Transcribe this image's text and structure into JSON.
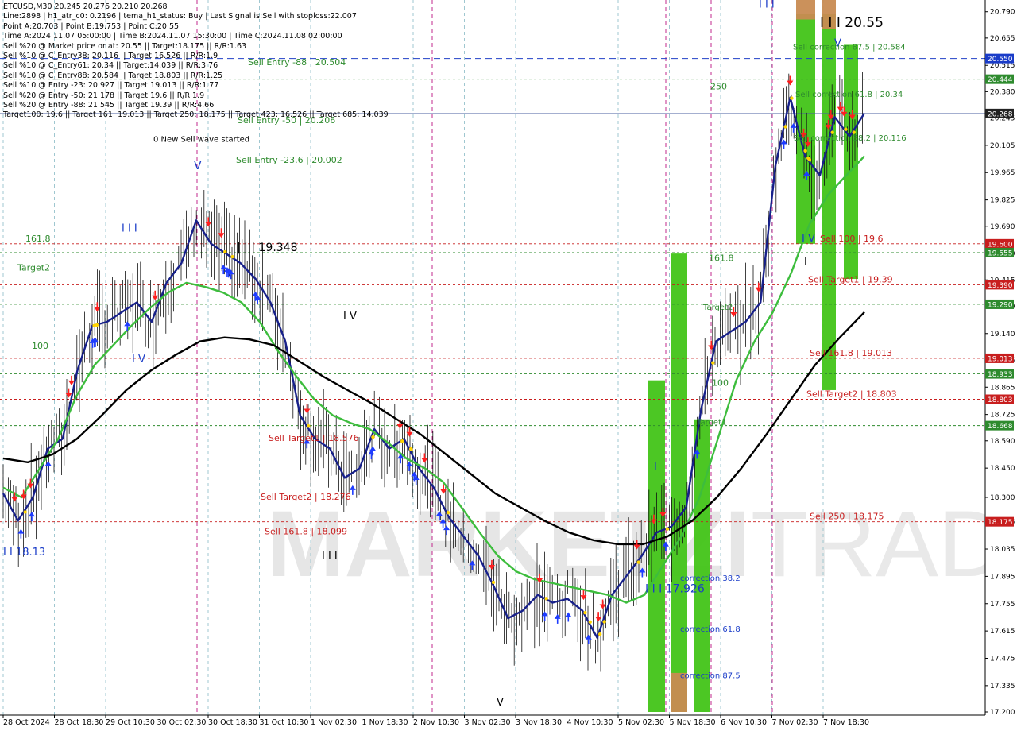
{
  "info_panel": {
    "lines": [
      "ETCUSD,M30  20.245 20.276 20.210 20.268",
      "Line:2898 | h1_atr_c0: 0.2196 | tema_h1_status: Buy | Last Signal is:Sell with stoploss:22.007",
      "Point A:20.703 | Point B:19.753 | Point C:20.55",
      "Time A:2024.11.07 05:00:00 | Time B:2024.11.07 15:30:00 | Time C:2024.11.08 02:00:00",
      "Sell %20 @ Market price or at: 20.55 || Target:18.175 || R/R:1.63",
      "Sell %10 @ C_Entry38: 20.116 || Target:16.526 || R/R:1.9",
      "Sell %10 @ C_Entry61: 20.34 || Target:14.039 || R/R:3.76",
      "Sell %10 @ C_Entry88: 20.584 || Target:18.803 || R/R:1.25",
      "Sell %10 @ Entry -23: 20.927 || Target:19.013 || R/R:1.77",
      "Sell %20 @ Entry -50: 21.178 || Target:19.6 || R/R:1.9",
      "Sell %20 @ Entry -88: 21.545 || Target:19.39 || R/R:4.66",
      "Target100: 19.6 || Target 161: 19.013 || Target 250: 18.175 || Target 423: 16.526 || Target 685: 14.039"
    ]
  },
  "chart_data": {
    "type": "line",
    "symbol": "ETCUSD",
    "timeframe": "M30",
    "ohlc": {
      "open": 20.245,
      "high": 20.276,
      "low": 20.21,
      "close": 20.268
    },
    "ylim": [
      17.2,
      20.85
    ],
    "y_ticks": [
      20.79,
      20.655,
      20.515,
      20.38,
      20.245,
      20.105,
      19.965,
      19.825,
      19.69,
      19.55,
      19.415,
      19.28,
      19.14,
      19.005,
      18.865,
      18.725,
      18.59,
      18.45,
      18.3,
      18.175,
      18.035,
      17.895,
      17.755,
      17.615,
      17.475,
      17.335,
      17.2
    ],
    "y_tick_labels": [
      "20.790",
      "20.655",
      "20.515",
      "20.380",
      "20.245",
      "20.105",
      "19.965",
      "19.825",
      "19.690",
      "19.550",
      "19.415",
      "19.280",
      "19.140",
      "19.005",
      "18.865",
      "18.725",
      "18.590",
      "18.450",
      "18.300",
      "18.175",
      "18.035",
      "17.895",
      "17.755",
      "17.615",
      "17.475",
      "17.335",
      "17.200"
    ],
    "x_tick_labels": [
      "28 Oct 2024",
      "28 Oct 18:30",
      "29 Oct 10:30",
      "30 Oct 02:30",
      "30 Oct 18:30",
      "31 Oct 10:30",
      "1 Nov 02:30",
      "1 Nov 18:30",
      "2 Nov 10:30",
      "3 Nov 02:30",
      "3 Nov 18:30",
      "4 Nov 10:30",
      "5 Nov 02:30",
      "5 Nov 18:30",
      "6 Nov 10:30",
      "7 Nov 02:30",
      "7 Nov 18:30"
    ],
    "price_badges": [
      {
        "label": "20.550",
        "value": 20.55,
        "color": "#1a3cc8"
      },
      {
        "label": "20.444",
        "value": 20.444,
        "color": "#2e8b2e"
      },
      {
        "label": "20.268",
        "value": 20.268,
        "color": "#222222"
      },
      {
        "label": "19.600",
        "value": 19.6,
        "color": "#c81e1e"
      },
      {
        "label": "19.555",
        "value": 19.555,
        "color": "#2e8b2e"
      },
      {
        "label": "19.390",
        "value": 19.39,
        "color": "#c81e1e"
      },
      {
        "label": "19.290",
        "value": 19.29,
        "color": "#2e8b2e"
      },
      {
        "label": "19.013",
        "value": 19.013,
        "color": "#c81e1e"
      },
      {
        "label": "18.933",
        "value": 18.933,
        "color": "#2e8b2e"
      },
      {
        "label": "18.803",
        "value": 18.803,
        "color": "#c81e1e"
      },
      {
        "label": "18.668",
        "value": 18.668,
        "color": "#2e8b2e"
      },
      {
        "label": "18.175",
        "value": 18.175,
        "color": "#c81e1e"
      }
    ],
    "annotations": [
      {
        "text": "Sell Entry -88 | 20.504",
        "price": 20.504,
        "color": "#2e8b2e"
      },
      {
        "text": "Sell Entry -50 | 20.206",
        "price": 20.206,
        "color": "#2e8b2e"
      },
      {
        "text": "0 New Sell wave started",
        "price": 20.11,
        "color": "#000000"
      },
      {
        "text": "Sell Entry -23.6 | 20.002",
        "price": 20.002,
        "color": "#2e8b2e"
      },
      {
        "text": "161.8",
        "price": 19.6,
        "color": "#2e8b2e"
      },
      {
        "text": "Target2",
        "price": 19.45,
        "color": "#2e8b2e"
      },
      {
        "text": "100",
        "price": 19.05,
        "color": "#2e8b2e"
      },
      {
        "text": "| | | 19.348",
        "price": 19.55,
        "color": "#000000"
      },
      {
        "text": "I V",
        "price": 19.2,
        "color": "#000000"
      },
      {
        "text": "I V",
        "price": 18.98,
        "color": "#1a3cc8"
      },
      {
        "text": "I I I",
        "price": 19.65,
        "color": "#1a3cc8"
      },
      {
        "text": "V",
        "price": 19.97,
        "color": "#1a3cc8"
      },
      {
        "text": "Sell Target1 | 18.576",
        "price": 18.576,
        "color": "#c81e1e"
      },
      {
        "text": "Sell Target2 | 18.276",
        "price": 18.276,
        "color": "#c81e1e"
      },
      {
        "text": "Sell 161.8 | 18.099",
        "price": 18.099,
        "color": "#c81e1e"
      },
      {
        "text": "I I I",
        "price": 17.97,
        "color": "#000000"
      },
      {
        "text": "I I 18.13",
        "price": 17.99,
        "color": "#1a3cc8"
      },
      {
        "text": "V",
        "price": 17.22,
        "color": "#000000"
      },
      {
        "text": "250",
        "price": 20.38,
        "color": "#2e8b2e"
      },
      {
        "text": "161.8",
        "price": 19.5,
        "color": "#2e8b2e"
      },
      {
        "text": "Target2",
        "price": 19.25,
        "color": "#2e8b2e"
      },
      {
        "text": "100",
        "price": 18.86,
        "color": "#2e8b2e"
      },
      {
        "text": "Target1",
        "price": 18.66,
        "color": "#2e8b2e"
      },
      {
        "text": "I",
        "price": 18.43,
        "color": "#1a3cc8"
      },
      {
        "text": "I I I 17.926",
        "price": 17.8,
        "color": "#1a3cc8"
      },
      {
        "text": "correction 38.2",
        "price": 17.86,
        "color": "#1a3cc8"
      },
      {
        "text": "correction 61.8",
        "price": 17.6,
        "color": "#1a3cc8"
      },
      {
        "text": "correction 87.5",
        "price": 17.36,
        "color": "#1a3cc8"
      },
      {
        "text": "I I I",
        "price": 20.8,
        "color": "#1a3cc8"
      },
      {
        "text": "I I I 20.55",
        "price": 20.7,
        "color": "#000000"
      },
      {
        "text": "V",
        "price": 20.6,
        "color": "#1a3cc8"
      },
      {
        "text": "Sell correction 87.5 | 20.584",
        "price": 20.584,
        "color": "#2e8b2e"
      },
      {
        "text": "Sell correction 61.8 | 20.34",
        "price": 20.34,
        "color": "#2e8b2e"
      },
      {
        "text": "Sell correction 38.2 | 20.116",
        "price": 20.116,
        "color": "#2e8b2e"
      },
      {
        "text": "I V",
        "price": 19.6,
        "color": "#1a3cc8"
      },
      {
        "text": "I",
        "price": 19.48,
        "color": "#000000"
      },
      {
        "text": "Sell 100 | 19.6",
        "price": 19.6,
        "color": "#c81e1e"
      },
      {
        "text": "Sell Target1 | 19.39",
        "price": 19.39,
        "color": "#c81e1e"
      },
      {
        "text": "Sell 161.8 | 19.013",
        "price": 19.013,
        "color": "#c81e1e"
      },
      {
        "text": "Sell Target2 | 18.803",
        "price": 18.803,
        "color": "#c81e1e"
      },
      {
        "text": "Sell 250 | 18.175",
        "price": 18.175,
        "color": "#c81e1e"
      }
    ],
    "series": [
      {
        "values": [
          18.32,
          18.18,
          18.3,
          18.55,
          18.6,
          18.95,
          19.18,
          19.2,
          19.25,
          19.3,
          19.2,
          19.4,
          19.5,
          19.72,
          19.6,
          19.55,
          19.5,
          19.42,
          19.3,
          19.1,
          18.72,
          18.6,
          18.55,
          18.4,
          18.45,
          18.65,
          18.55,
          18.6,
          18.45,
          18.35,
          18.2,
          18.1,
          18.0,
          17.85,
          17.68,
          17.72,
          17.8,
          17.76,
          17.78,
          17.72,
          17.58,
          17.8,
          17.9,
          18.0,
          18.12,
          18.15,
          18.25,
          18.75,
          19.1,
          19.15,
          19.2,
          19.3,
          20.0,
          20.35,
          20.05,
          19.95,
          20.25,
          20.15,
          20.27
        ]
      },
      {
        "values": [
          18.35,
          18.3,
          18.45,
          18.6,
          18.82,
          18.98,
          19.08,
          19.18,
          19.27,
          19.35,
          19.4,
          19.38,
          19.35,
          19.3,
          19.2,
          19.05,
          18.92,
          18.8,
          18.72,
          18.68,
          18.65,
          18.58,
          18.5,
          18.45,
          18.38,
          18.25,
          18.12,
          18.0,
          17.92,
          17.88,
          17.86,
          17.84,
          17.82,
          17.8,
          17.76,
          17.8,
          17.95,
          18.1,
          18.3,
          18.6,
          18.9,
          19.1,
          19.25,
          19.45,
          19.7,
          19.85,
          19.95,
          20.05
        ]
      },
      {
        "values": [
          18.5,
          18.48,
          18.52,
          18.6,
          18.72,
          18.85,
          18.95,
          19.03,
          19.1,
          19.12,
          19.11,
          19.08,
          19.0,
          18.92,
          18.85,
          18.78,
          18.7,
          18.62,
          18.52,
          18.42,
          18.32,
          18.25,
          18.18,
          18.12,
          18.08,
          18.06,
          18.06,
          18.1,
          18.18,
          18.3,
          18.45,
          18.62,
          18.8,
          18.98,
          19.12,
          19.25
        ]
      }
    ]
  }
}
